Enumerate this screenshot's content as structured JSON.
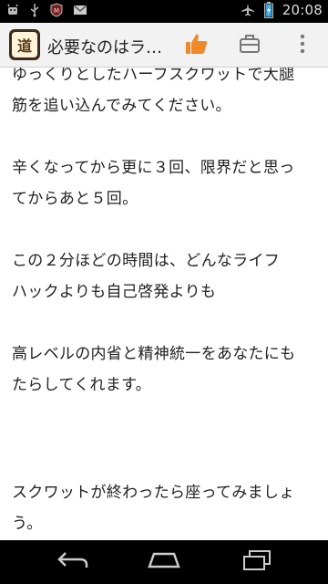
{
  "status_bar": {
    "time": "20:08",
    "icons": [
      "android-debug-icon",
      "usb-icon",
      "mcafee-icon",
      "gmail-icon",
      "airplane-mode-icon",
      "battery-charging-icon"
    ]
  },
  "action_bar": {
    "app_icon_text": "道",
    "title": "必要なのはラ…",
    "buttons": [
      "thumbs-up-icon",
      "briefcase-icon",
      "overflow-menu-icon"
    ],
    "accent_color": "#f0892a"
  },
  "content": {
    "paragraphs": [
      {
        "line1": "ゆっくりとしたハーフスクワットで大腿",
        "line2": "筋を追い込んでみてください。"
      },
      {
        "line1": "辛くなってから更に３回、限界だと思っ",
        "line2": "てからあと５回。"
      },
      {
        "line1": "この２分ほどの時間は、どんなライフ",
        "line2": "ハックよりも自己啓発よりも"
      },
      {
        "line1": "高レベルの内省と精神統一をあなたにも",
        "line2": "たらしてくれます。"
      },
      {
        "line1": "スクワットが終わったら座ってみましょ",
        "line2": "う。"
      }
    ]
  },
  "nav_bar": {
    "buttons": [
      "back-icon",
      "home-icon",
      "recent-apps-icon"
    ]
  }
}
